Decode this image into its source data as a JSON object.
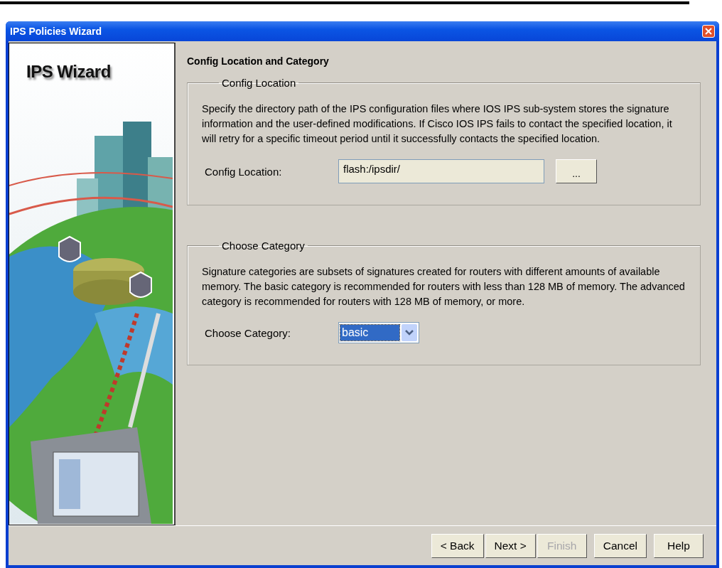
{
  "window": {
    "title": "IPS Policies Wizard"
  },
  "sidebar": {
    "title": "IPS Wizard"
  },
  "page": {
    "heading": "Config Location and Category"
  },
  "config_location": {
    "legend": "Config Location",
    "description": "Specify the directory path of the IPS configuration files where IOS IPS sub-system stores the signature information and the user-defined modifications. If Cisco IOS IPS fails to contact the specified location, it will retry for a specific timeout period until it successfully contacts the specified location.",
    "label": "Config Location:",
    "value": "flash:/ipsdir/",
    "browse_button": "..."
  },
  "choose_category": {
    "legend": "Choose Category",
    "description": "Signature categories are subsets of signatures created for routers with different amounts of available memory. The basic category is recommended for routers with less than 128 MB of memory. The advanced category is recommended for routers with 128 MB of memory, or more.",
    "label": "Choose Category:",
    "value": "basic"
  },
  "buttons": [
    {
      "label": "< Back",
      "disabled": false
    },
    {
      "label": "Next >",
      "disabled": false
    },
    {
      "label": "Finish",
      "disabled": true
    },
    {
      "label": "Cancel",
      "disabled": false
    },
    {
      "label": "Help",
      "disabled": false
    }
  ]
}
